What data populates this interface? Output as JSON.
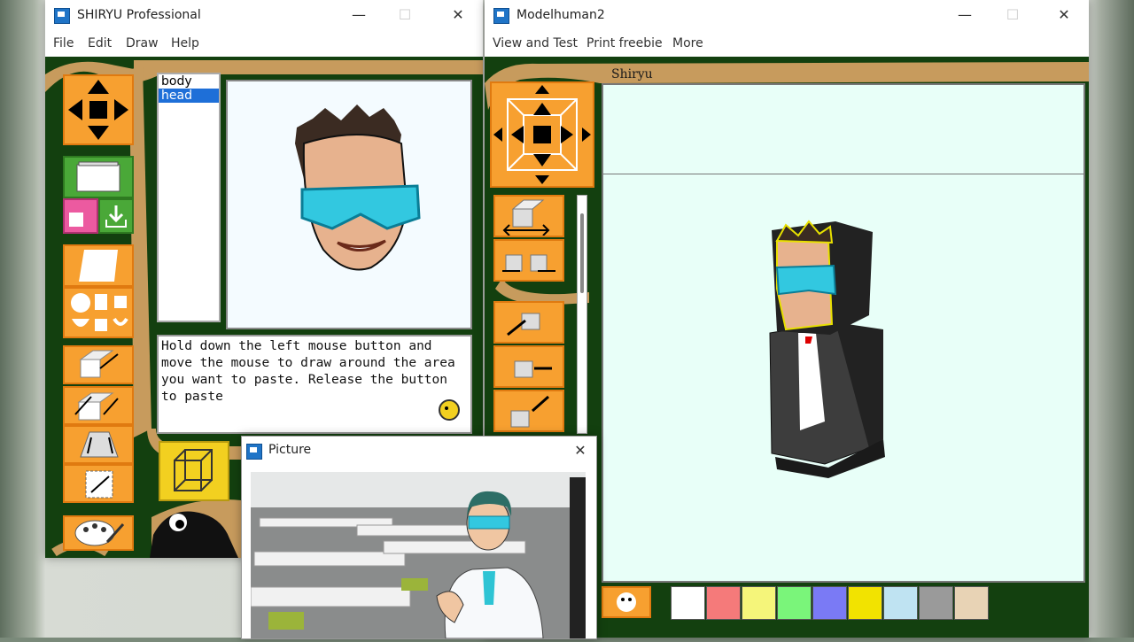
{
  "left_window": {
    "title": "SHIRYU Professional",
    "menu": [
      "File",
      "Edit",
      "Draw",
      "Help"
    ],
    "parts_list": [
      "body",
      "head"
    ],
    "selected_part": "head",
    "help_text": "Hold down the left mouse button and move the mouse to draw around the area you want to paste. Release the button to paste"
  },
  "right_window": {
    "title": "Modelhuman2",
    "menu": [
      "View and Test",
      "Print freebie",
      "More"
    ],
    "brand_label": "Shiryu"
  },
  "picture_window": {
    "title": "Picture"
  },
  "palette_colors": [
    "#ffffff",
    "#f57a7a",
    "#f5f57a",
    "#7af57a",
    "#7a7af5",
    "#f2e300",
    "#bfe3f2",
    "#9a9a9a",
    "#e8d3b5"
  ],
  "colors": {
    "app_green": "#13400f",
    "tool_orange": "#f7a030",
    "canvas_bg": "#e8fff8",
    "selection_blue": "#1e6fd8"
  }
}
